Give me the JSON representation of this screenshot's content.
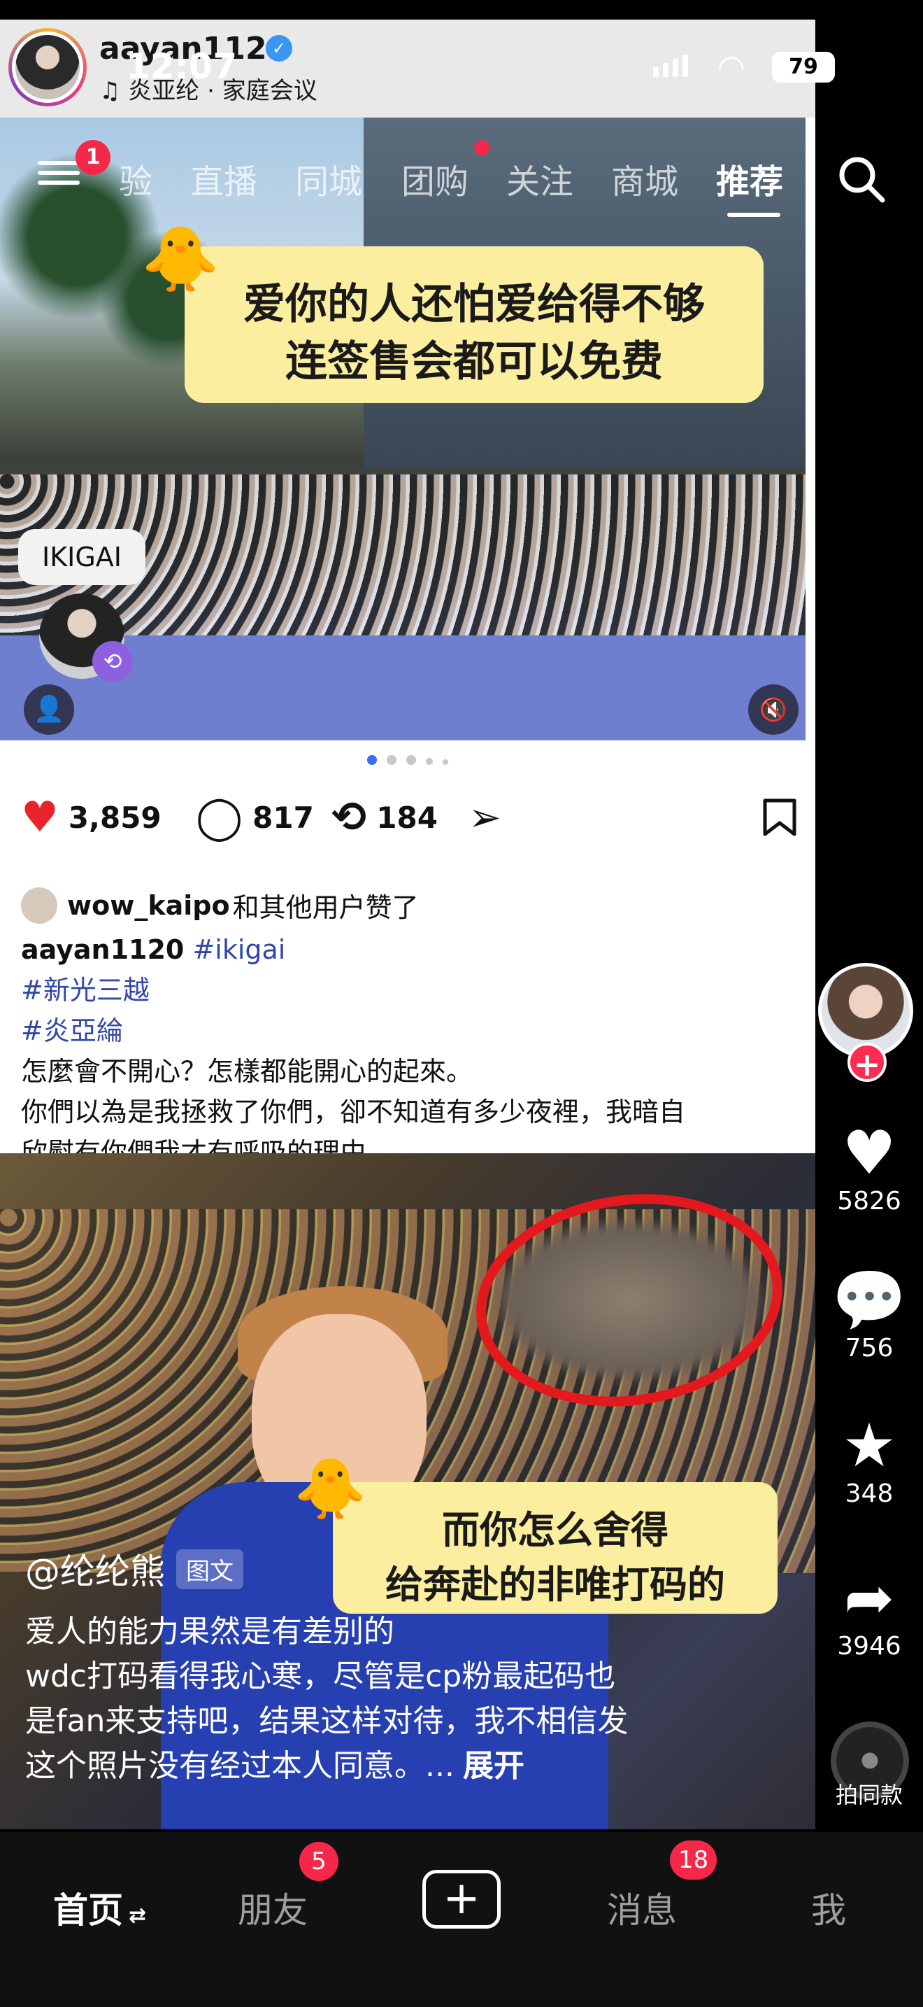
{
  "status_bar": {
    "time": "12:07",
    "battery": "79"
  },
  "card": {
    "username": "aayan1120",
    "music": "♫ 炎亚纶 · 家庭会议",
    "overlay_caption_1": [
      "爱你的人还怕爱给得不够",
      "连签售会都可以免费"
    ],
    "tag_label": "IKIGAI",
    "carousel_index": 1,
    "carousel_total": 5,
    "likes": "3,859",
    "comments": "817",
    "reposts": "184",
    "liked_by_user": "wow_kaipo",
    "liked_by_suffix": "和其他用户赞了",
    "caption_user": "aayan1120",
    "hashtags": [
      "#ikigai",
      "#新光三越",
      "#炎亞綸"
    ],
    "caption_text": [
      "怎麼會不開心？怎樣都能開心的起來。",
      "你們以為是我拯救了你們，卻不知道有多少夜裡，我暗自",
      "欣慰有你們我才有呼吸的理由。"
    ]
  },
  "video": {
    "overlay_caption_2": [
      "而你怎么舍得",
      "给奔赴的非唯打码的"
    ]
  },
  "top_tabs": {
    "menu_badge": "1",
    "tabs": [
      "验",
      "直播",
      "同城",
      "团购",
      "关注",
      "商城",
      "推荐"
    ],
    "active_tab": "推荐"
  },
  "right_rail": {
    "likes": "5826",
    "comments": "756",
    "favorites": "348",
    "shares": "3946",
    "same_style_label": "拍同款"
  },
  "post_info": {
    "author": "@纶纶熊",
    "type_label": "图文",
    "description": [
      "爱人的能力果然是有差别的",
      "wdc打码看得我心寒，尽管是cp粉最起码也",
      "是fan来支持吧，结果这样对待，我不相信发",
      "这个照片没有经过本人同意。..."
    ],
    "expand_label": "展开"
  },
  "bottom_nav": {
    "home": "首页",
    "friends": "朋友",
    "friends_badge": "5",
    "messages": "消息",
    "messages_badge": "18",
    "me": "我"
  },
  "colors": {
    "accent_red": "#fe2c55",
    "hashtag_blue": "#3147a8",
    "caption_bg": "#fbee9e"
  }
}
